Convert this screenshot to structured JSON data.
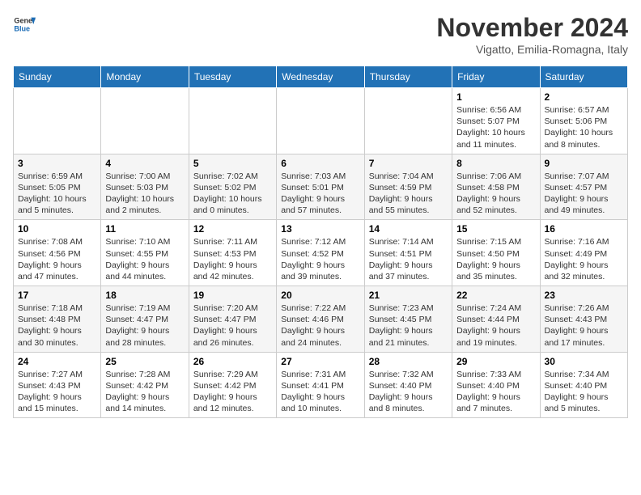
{
  "header": {
    "logo_general": "General",
    "logo_blue": "Blue",
    "month_title": "November 2024",
    "subtitle": "Vigatto, Emilia-Romagna, Italy"
  },
  "weekdays": [
    "Sunday",
    "Monday",
    "Tuesday",
    "Wednesday",
    "Thursday",
    "Friday",
    "Saturday"
  ],
  "weeks": [
    [
      {
        "day": "",
        "info": ""
      },
      {
        "day": "",
        "info": ""
      },
      {
        "day": "",
        "info": ""
      },
      {
        "day": "",
        "info": ""
      },
      {
        "day": "",
        "info": ""
      },
      {
        "day": "1",
        "info": "Sunrise: 6:56 AM\nSunset: 5:07 PM\nDaylight: 10 hours and 11 minutes."
      },
      {
        "day": "2",
        "info": "Sunrise: 6:57 AM\nSunset: 5:06 PM\nDaylight: 10 hours and 8 minutes."
      }
    ],
    [
      {
        "day": "3",
        "info": "Sunrise: 6:59 AM\nSunset: 5:05 PM\nDaylight: 10 hours and 5 minutes."
      },
      {
        "day": "4",
        "info": "Sunrise: 7:00 AM\nSunset: 5:03 PM\nDaylight: 10 hours and 2 minutes."
      },
      {
        "day": "5",
        "info": "Sunrise: 7:02 AM\nSunset: 5:02 PM\nDaylight: 10 hours and 0 minutes."
      },
      {
        "day": "6",
        "info": "Sunrise: 7:03 AM\nSunset: 5:01 PM\nDaylight: 9 hours and 57 minutes."
      },
      {
        "day": "7",
        "info": "Sunrise: 7:04 AM\nSunset: 4:59 PM\nDaylight: 9 hours and 55 minutes."
      },
      {
        "day": "8",
        "info": "Sunrise: 7:06 AM\nSunset: 4:58 PM\nDaylight: 9 hours and 52 minutes."
      },
      {
        "day": "9",
        "info": "Sunrise: 7:07 AM\nSunset: 4:57 PM\nDaylight: 9 hours and 49 minutes."
      }
    ],
    [
      {
        "day": "10",
        "info": "Sunrise: 7:08 AM\nSunset: 4:56 PM\nDaylight: 9 hours and 47 minutes."
      },
      {
        "day": "11",
        "info": "Sunrise: 7:10 AM\nSunset: 4:55 PM\nDaylight: 9 hours and 44 minutes."
      },
      {
        "day": "12",
        "info": "Sunrise: 7:11 AM\nSunset: 4:53 PM\nDaylight: 9 hours and 42 minutes."
      },
      {
        "day": "13",
        "info": "Sunrise: 7:12 AM\nSunset: 4:52 PM\nDaylight: 9 hours and 39 minutes."
      },
      {
        "day": "14",
        "info": "Sunrise: 7:14 AM\nSunset: 4:51 PM\nDaylight: 9 hours and 37 minutes."
      },
      {
        "day": "15",
        "info": "Sunrise: 7:15 AM\nSunset: 4:50 PM\nDaylight: 9 hours and 35 minutes."
      },
      {
        "day": "16",
        "info": "Sunrise: 7:16 AM\nSunset: 4:49 PM\nDaylight: 9 hours and 32 minutes."
      }
    ],
    [
      {
        "day": "17",
        "info": "Sunrise: 7:18 AM\nSunset: 4:48 PM\nDaylight: 9 hours and 30 minutes."
      },
      {
        "day": "18",
        "info": "Sunrise: 7:19 AM\nSunset: 4:47 PM\nDaylight: 9 hours and 28 minutes."
      },
      {
        "day": "19",
        "info": "Sunrise: 7:20 AM\nSunset: 4:47 PM\nDaylight: 9 hours and 26 minutes."
      },
      {
        "day": "20",
        "info": "Sunrise: 7:22 AM\nSunset: 4:46 PM\nDaylight: 9 hours and 24 minutes."
      },
      {
        "day": "21",
        "info": "Sunrise: 7:23 AM\nSunset: 4:45 PM\nDaylight: 9 hours and 21 minutes."
      },
      {
        "day": "22",
        "info": "Sunrise: 7:24 AM\nSunset: 4:44 PM\nDaylight: 9 hours and 19 minutes."
      },
      {
        "day": "23",
        "info": "Sunrise: 7:26 AM\nSunset: 4:43 PM\nDaylight: 9 hours and 17 minutes."
      }
    ],
    [
      {
        "day": "24",
        "info": "Sunrise: 7:27 AM\nSunset: 4:43 PM\nDaylight: 9 hours and 15 minutes."
      },
      {
        "day": "25",
        "info": "Sunrise: 7:28 AM\nSunset: 4:42 PM\nDaylight: 9 hours and 14 minutes."
      },
      {
        "day": "26",
        "info": "Sunrise: 7:29 AM\nSunset: 4:42 PM\nDaylight: 9 hours and 12 minutes."
      },
      {
        "day": "27",
        "info": "Sunrise: 7:31 AM\nSunset: 4:41 PM\nDaylight: 9 hours and 10 minutes."
      },
      {
        "day": "28",
        "info": "Sunrise: 7:32 AM\nSunset: 4:40 PM\nDaylight: 9 hours and 8 minutes."
      },
      {
        "day": "29",
        "info": "Sunrise: 7:33 AM\nSunset: 4:40 PM\nDaylight: 9 hours and 7 minutes."
      },
      {
        "day": "30",
        "info": "Sunrise: 7:34 AM\nSunset: 4:40 PM\nDaylight: 9 hours and 5 minutes."
      }
    ]
  ]
}
